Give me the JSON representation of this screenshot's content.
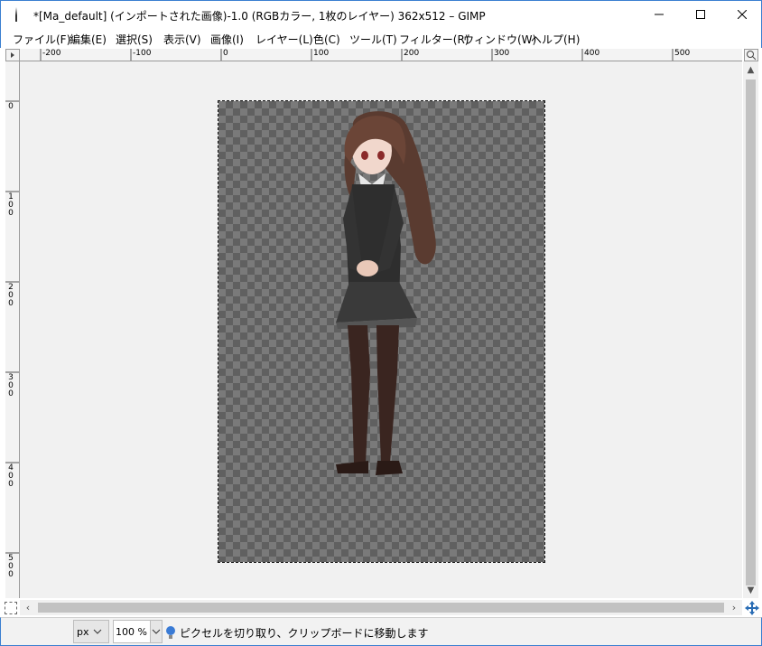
{
  "window": {
    "title": "*[Ma_default] (インポートされた画像)-1.0 (RGBカラー, 1枚のレイヤー) 362x512 – GIMP"
  },
  "menu": [
    "ファイル(F)",
    "編集(E)",
    "選択(S)",
    "表示(V)",
    "画像(I)",
    "レイヤー(L)",
    "色(C)",
    "ツール(T)",
    "フィルター(R)",
    "ウィンドウ(W)",
    "ヘルプ(H)"
  ],
  "ruler_top": [
    "-200",
    "-100",
    "0",
    "100",
    "200",
    "300",
    "400",
    "500"
  ],
  "ruler_left": [
    [
      "0"
    ],
    [
      "1",
      "0",
      "0"
    ],
    [
      "2",
      "0",
      "0"
    ],
    [
      "3",
      "0",
      "0"
    ],
    [
      "4",
      "0",
      "0"
    ],
    [
      "5",
      "0",
      "0"
    ]
  ],
  "status": {
    "unit": "px",
    "zoom": "100 %",
    "message": "ピクセルを切り取り、クリップボードに移動します"
  },
  "colors": {
    "accent_border": "#3a7fd0",
    "checker_dark": "#606060",
    "checker_light": "#7a7a7a"
  }
}
